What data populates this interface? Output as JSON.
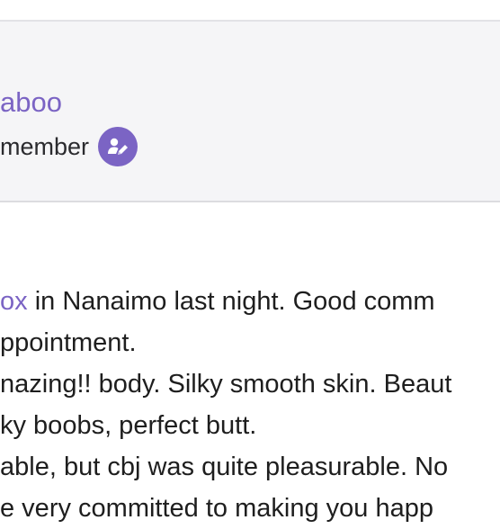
{
  "profile": {
    "username": "aboo",
    "role": "member",
    "role_badge_icon": "user-edit-icon",
    "accent_color": "#7b64c4"
  },
  "post": {
    "line1": {
      "link_text": "ox",
      "rest": " in Nanaimo last night. Good comm"
    },
    "line2": "ppointment.",
    "line3": "nazing!! body. Silky smooth skin. Beaut",
    "line4": "ky boobs, perfect butt.",
    "line5": "able, but cbj was quite pleasurable. No",
    "line6": "e very committed to making you happ"
  }
}
